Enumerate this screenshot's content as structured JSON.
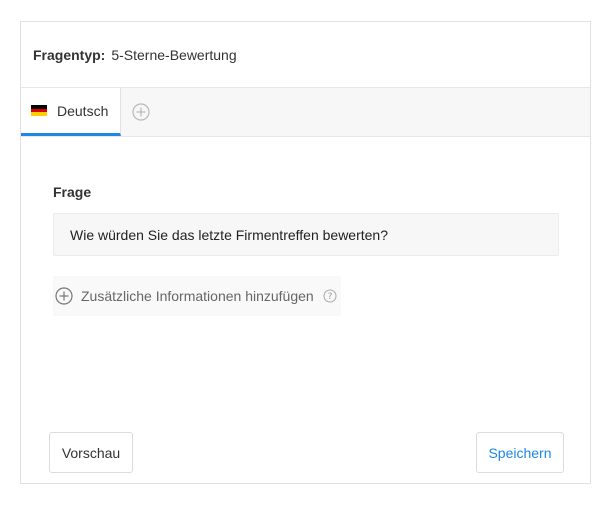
{
  "header": {
    "question_type_label": "Fragentyp:",
    "question_type_value": "5-Sterne-Bewertung"
  },
  "tabs": {
    "active_language": "Deutsch",
    "flag_colors": [
      "#000000",
      "#dd0000",
      "#ffce00"
    ],
    "add_icon": "plus-circle-icon"
  },
  "form": {
    "question_label": "Frage",
    "question_value": "Wie würden Sie das letzte Firmentreffen bewerten?",
    "add_info_label": "Zusätzliche Informationen hinzufügen",
    "add_info_icon": "plus-circle-icon",
    "help_icon": "question-circle-icon"
  },
  "footer": {
    "preview_label": "Vorschau",
    "save_label": "Speichern"
  },
  "colors": {
    "accent": "#1e88e5"
  }
}
